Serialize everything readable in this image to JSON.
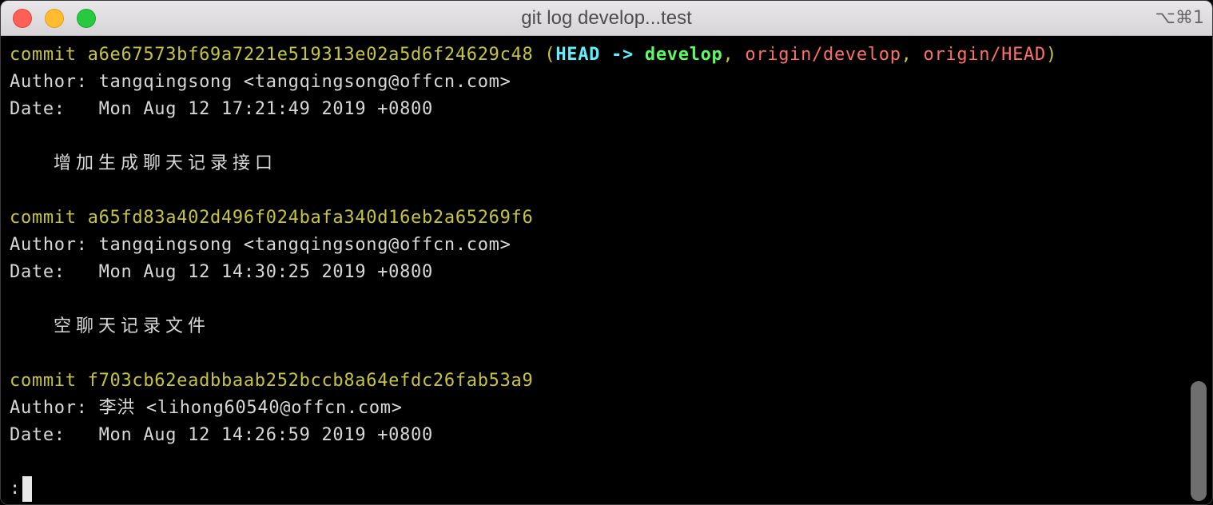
{
  "window": {
    "title": "git log develop...test",
    "shortcut": "⌥⌘1"
  },
  "commits": [
    {
      "keyword": "commit",
      "hash": "a6e67573bf69a7221e519313e02a5d6f24629c48",
      "refs": {
        "open": " (",
        "head": "HEAD",
        "arrow": " -> ",
        "branch": "develop",
        "sep1": ", ",
        "remote1": "origin/develop",
        "sep2": ", ",
        "remote2": "origin/HEAD",
        "close": ")"
      },
      "author_label": "Author:",
      "author": "tangqingsong <tangqingsong@offcn.com>",
      "date_label": "Date:",
      "date": "Mon Aug 12 17:21:49 2019 +0800",
      "message": "增加生成聊天记录接口"
    },
    {
      "keyword": "commit",
      "hash": "a65fd83a402d496f024bafa340d16eb2a65269f6",
      "author_label": "Author:",
      "author": "tangqingsong <tangqingsong@offcn.com>",
      "date_label": "Date:",
      "date": "Mon Aug 12 14:30:25 2019 +0800",
      "message": "空聊天记录文件"
    },
    {
      "keyword": "commit",
      "hash": "f703cb62eadbbaab252bccb8a64efdc26fab53a9",
      "author_label": "Author:",
      "author": "李洪 <lihong60540@offcn.com>",
      "date_label": "Date:",
      "date": "Mon Aug 12 14:26:59 2019 +0800"
    }
  ],
  "pager": {
    "prompt": ":"
  },
  "colors": {
    "hash": "#c7c43a",
    "head": "#5ff0ff",
    "branch": "#5ff967",
    "remote": "#ff6e67",
    "text": "#d8d8d8",
    "background": "#000000"
  }
}
